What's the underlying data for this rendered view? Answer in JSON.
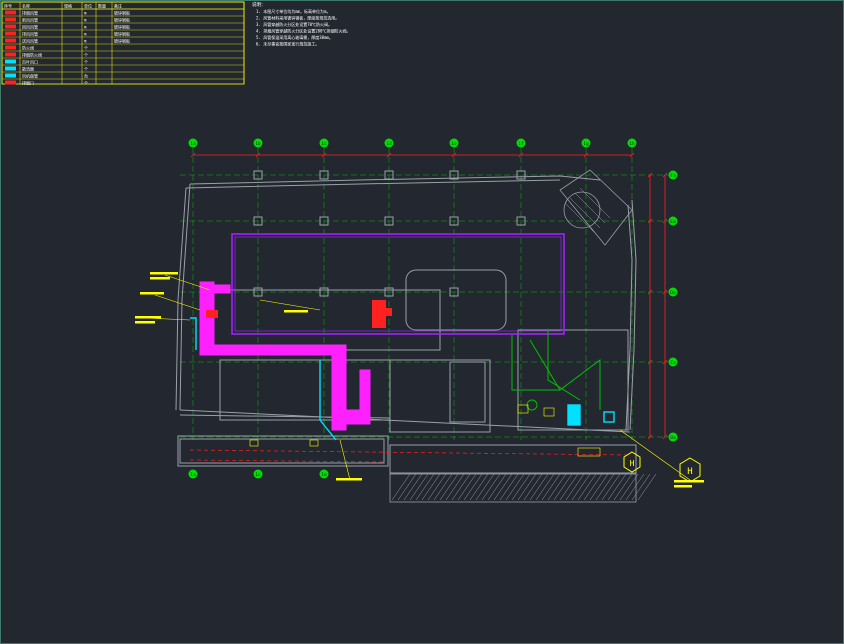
{
  "colors": {
    "background": "#232830",
    "wall": "#9aa0a8",
    "axis": "#00e000",
    "dimension": "#ff2020",
    "duct_magenta": "#ff20ff",
    "cyan": "#00e0ff",
    "yellow": "#ffff00",
    "purple_boundary": "#a020ff",
    "green": "#00c000"
  },
  "legend": {
    "headers": [
      "序号",
      "名称",
      "规格",
      "单位",
      "数量",
      "备注"
    ],
    "rows": [
      {
        "no": "1",
        "name": "排烟风管",
        "unit": "m",
        "note": "镀锌钢板"
      },
      {
        "no": "2",
        "name": "新风风管",
        "unit": "m",
        "note": "镀锌钢板"
      },
      {
        "no": "3",
        "name": "回风风管",
        "unit": "m",
        "note": "镀锌钢板"
      },
      {
        "no": "4",
        "name": "排风风管",
        "unit": "m",
        "note": "镀锌钢板"
      },
      {
        "no": "5",
        "name": "送风风管",
        "unit": "m",
        "note": "镀锌钢板"
      },
      {
        "no": "6",
        "name": "防火阀",
        "unit": "个",
        "note": ""
      },
      {
        "no": "7",
        "name": "排烟防火阀",
        "unit": "个",
        "note": ""
      },
      {
        "no": "8",
        "name": "百叶风口",
        "unit": "个",
        "note": ""
      },
      {
        "no": "9",
        "name": "散流器",
        "unit": "个",
        "note": ""
      },
      {
        "no": "10",
        "name": "风机盘管",
        "unit": "台",
        "note": ""
      },
      {
        "no": "11",
        "name": "排烟口",
        "unit": "个",
        "note": ""
      }
    ]
  },
  "notes": {
    "title": "说明：",
    "lines": [
      "1. 本图尺寸单位均为mm，标高单位为m。",
      "2. 风管材料采用镀锌钢板，厚度按规范选用。",
      "3. 风管穿越防火分区处设置70℃防火阀。",
      "4. 排烟风管穿越防火分区处设置280℃排烟防火阀。",
      "5. 风管保温采用离心玻璃棉，厚度30mm。",
      "6. 未尽事宜按国家现行规范施工。"
    ]
  },
  "axes_top": [
    "1a",
    "1b",
    "1c",
    "1d",
    "1e",
    "1f",
    "1g",
    "1h"
  ],
  "axes_bottom": [
    "1a",
    "1c",
    "1e"
  ],
  "axes_right": [
    "Fa",
    "Ea",
    "Da",
    "Ca",
    "Ba"
  ],
  "symbol_label": "H"
}
